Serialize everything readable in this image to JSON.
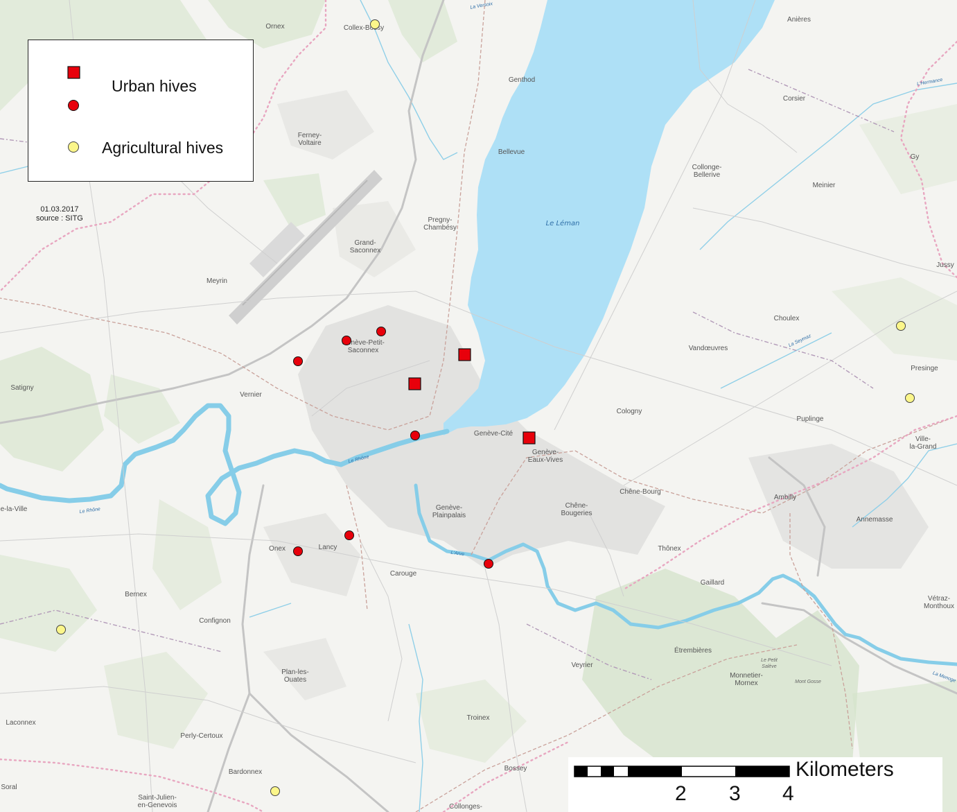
{
  "legend": {
    "urban_label": "Urban hives",
    "agricultural_label": "Agricultural hives"
  },
  "source": {
    "date": "01.03.2017",
    "source": "source : SITG"
  },
  "scale": {
    "unit": "Kilometers",
    "ticks": [
      "2",
      "3",
      "4"
    ]
  },
  "colors": {
    "urban": "#e8000b",
    "agricultural": "#fbf68a",
    "water": "#aee0f6"
  },
  "places": {
    "ornex": "Ornex",
    "collex": "Collex-Bossy",
    "genthod": "Genthod",
    "bellevue": "Bellevue",
    "ferney1": "Ferney-",
    "ferney2": "Voltaire",
    "pregny1": "Pregny-",
    "pregny2": "Chambésy",
    "grand1": "Grand-",
    "grand2": "Saconnex",
    "meyrin": "Meyrin",
    "petit1": "Genève-Petit-",
    "petit2": "Saconnex",
    "vernier": "Vernier",
    "satigny": "Satigny",
    "cite": "Genève-Cité",
    "eaux1": "Genève-",
    "eaux2": "Eaux-Vives",
    "plain1": "Genève-",
    "plain2": "Plainpalais",
    "chene1": "Chêne-",
    "chene2": "Bougeries",
    "chenebourg": "Chêne-Bourg",
    "onex": "Onex",
    "lancy": "Lancy",
    "carouge": "Carouge",
    "bernex": "Bernex",
    "confignon": "Confignon",
    "vilar": "e-la-Ville",
    "plan1": "Plan-les-",
    "plan2": "Ouates",
    "perly": "Perly-Certoux",
    "laconnex": "Laconnex",
    "bardonnex": "Bardonnex",
    "soral": "Soral",
    "stjulien1": "Saint-Julien-",
    "stjulien2": "en-Genevois",
    "troinex": "Troinex",
    "bossey": "Bossey",
    "collonges": "Collonges-",
    "veyrier": "Veyrier",
    "etrembieres": "Étrembières",
    "monnetier1": "Monnetier-",
    "monnetier2": "Mornex",
    "gaillard": "Gaillard",
    "thonex": "Thônex",
    "ambilly": "Ambilly",
    "annemasse": "Annemasse",
    "vetraz1": "Vétraz-",
    "vetraz2": "Monthoux",
    "ville1": "Ville-",
    "ville2": "la-Grand",
    "puplinge": "Puplinge",
    "presinge": "Presinge",
    "cologny": "Cologny",
    "vandoeuvres": "Vandœuvres",
    "choulex": "Choulex",
    "jussy": "Jussy",
    "meinier": "Meinier",
    "gy": "Gy",
    "collonge1": "Collonge-",
    "collonge2": "Bellerive",
    "corsier": "Corsier",
    "anieres": "Anières",
    "leman": "Le Léman",
    "rhone1": "Le Rhône",
    "rhone2": "Le Rhône",
    "arve": "L'Arve",
    "versoix": "La Versoix",
    "hermance": "L'Hermance",
    "seymaz": "La Seymaz",
    "saleve1": "Le Petit",
    "saleve2": "Salève",
    "montgosse": "Mont Gosse",
    "menoge": "La Menoge"
  }
}
